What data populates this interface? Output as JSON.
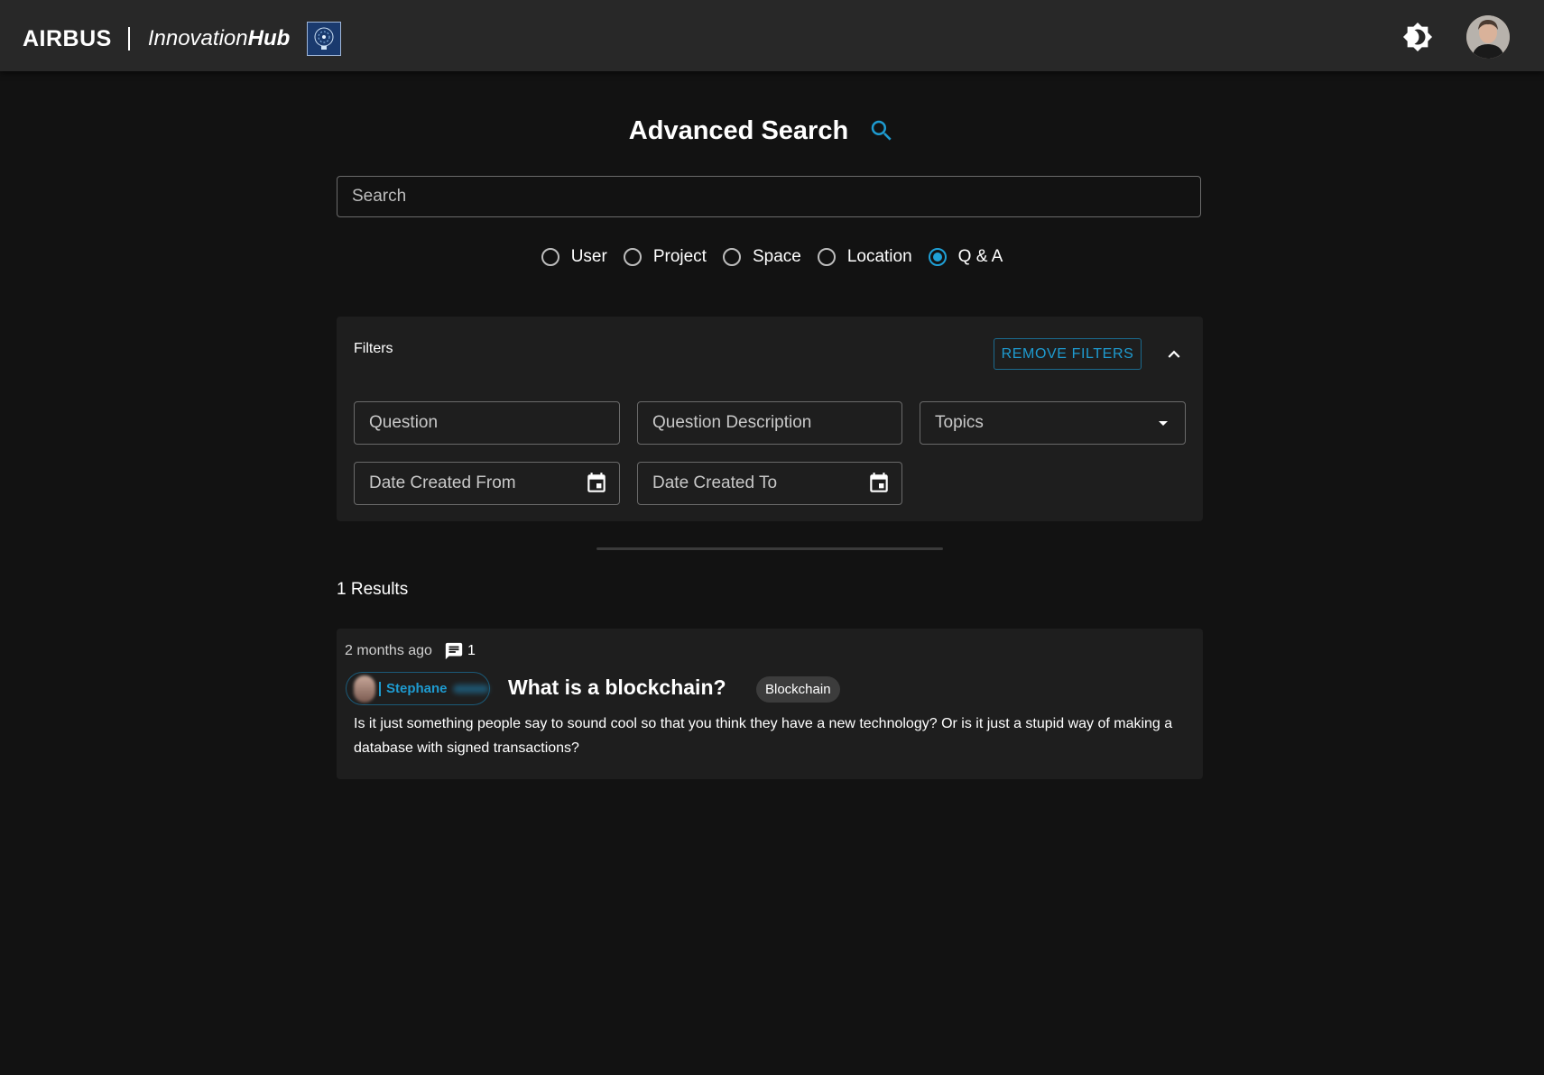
{
  "header": {
    "brand": "AIRBUS",
    "app_name_light": "Innovation",
    "app_name_bold": "Hub",
    "icons": {
      "theme_toggle": "brightness-icon",
      "avatar": "user-avatar"
    }
  },
  "page": {
    "title": "Advanced Search",
    "title_icon": "search-icon"
  },
  "search": {
    "placeholder": "Search"
  },
  "types": [
    {
      "label": "User",
      "checked": false
    },
    {
      "label": "Project",
      "checked": false
    },
    {
      "label": "Space",
      "checked": false
    },
    {
      "label": "Location",
      "checked": false
    },
    {
      "label": "Q & A",
      "checked": true
    }
  ],
  "filters": {
    "title": "Filters",
    "remove_label": "REMOVE FILTERS",
    "question_label": "Question",
    "description_label": "Question Description",
    "topics_label": "Topics",
    "date_from_label": "Date Created From",
    "date_to_label": "Date Created To"
  },
  "results": {
    "count_text": "1 Results",
    "items": [
      {
        "time_ago": "2 months ago",
        "comment_count": "1",
        "author": "Stephane",
        "title": "What is a blockchain?",
        "topic": "Blockchain",
        "description": "Is it just something people say to sound cool so that you think they have a new technology? Or is it just a stupid way of making a database with signed transactions?"
      }
    ]
  },
  "colors": {
    "accent": "#1e9bd0",
    "background": "#121212",
    "appbar": "#282828",
    "panel": "#1e1e1e"
  }
}
